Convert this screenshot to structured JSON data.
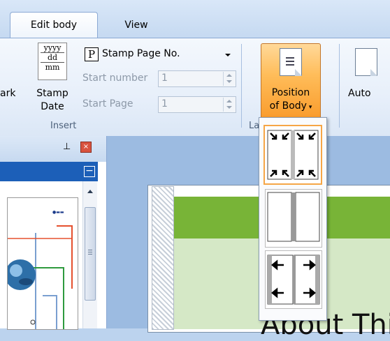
{
  "tabs": [
    {
      "label": "Edit body",
      "active": true
    },
    {
      "label": "View",
      "active": false
    }
  ],
  "ribbon": {
    "mark_label": "ark",
    "stamp_date": {
      "line1": "Stamp",
      "line2": "Date",
      "icon_lines": [
        "yyyy",
        "dd",
        "mm"
      ]
    },
    "stamp_page": {
      "icon": "P",
      "label": "Stamp Page No."
    },
    "start_number": {
      "label": "Start number",
      "value": "1"
    },
    "start_page": {
      "label": "Start Page",
      "value": "1"
    },
    "group_insert": "Insert",
    "group_layout": "La",
    "position_body": {
      "line1": "Position",
      "line2": "of Body"
    },
    "auto": "Auto"
  },
  "canvas": {
    "heading": "About Thi"
  },
  "dropdown": {
    "options": [
      "corners-inward",
      "two-pages",
      "side-arrows"
    ],
    "selected": 0
  },
  "colors": {
    "accent": "#f6a646",
    "pane_bar": "#1c5fb8",
    "green": "#78b437"
  }
}
